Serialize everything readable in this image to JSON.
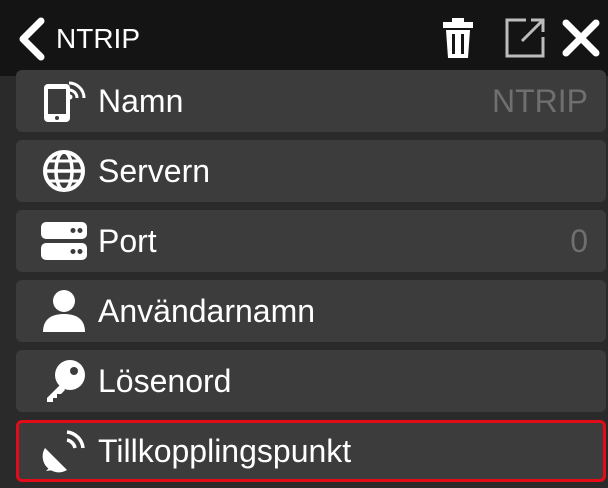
{
  "header": {
    "title": "NTRIP",
    "back_icon": "chevron-left-icon",
    "actions": [
      "trash-icon",
      "external-link-icon",
      "close-icon"
    ]
  },
  "rows": [
    {
      "label": "Namn",
      "value": "NTRIP",
      "icon": "phone-signal-icon"
    },
    {
      "label": "Servern",
      "value": "",
      "icon": "globe-icon"
    },
    {
      "label": "Port",
      "value": "0",
      "icon": "server-icon"
    },
    {
      "label": "Användarnamn",
      "value": "",
      "icon": "user-icon"
    },
    {
      "label": "Lösenord",
      "value": "",
      "icon": "key-icon"
    },
    {
      "label": "Tillkopplingspunkt",
      "value": "",
      "icon": "satellite-dish-icon"
    }
  ],
  "colors": {
    "header_bg": "#141414",
    "row_bg": "#3c3c3c",
    "screen_bg": "#2a2a2a",
    "value_text": "#6f6f6f",
    "selection_border": "#e30b17"
  }
}
